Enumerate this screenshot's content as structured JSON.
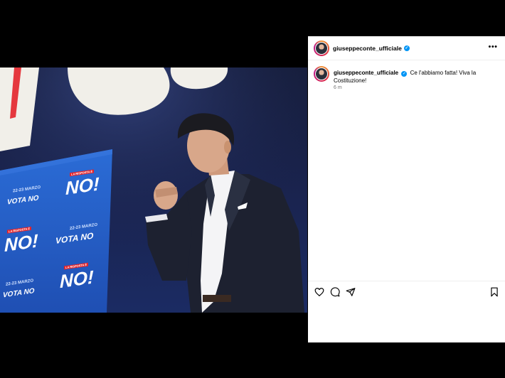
{
  "post": {
    "username": "giuseppeconte_ufficiale",
    "verified_badge": "✓",
    "more_label": "•••",
    "caption_user": "giuseppeconte_ufficiale",
    "caption_text": "Ce l'abbiamo fatta! Viva la Costituzione!",
    "time": "6 m"
  },
  "photo": {
    "backdrop_text": "NO!",
    "banners": [
      {
        "small": "LA RISPOSTA È",
        "date": "22-23 MARZO",
        "big": "NO!",
        "vote": "VOTA NO"
      },
      {
        "small": "LA RISPOSTA È",
        "date": "22-23 MARZO",
        "big": "NO!",
        "vote": "VOTA NO"
      },
      {
        "small": "LA RISPOSTA È",
        "date": "22-23 MARZO",
        "big": "NO!",
        "vote": "VOTA NO"
      }
    ]
  },
  "icons": {
    "like": "heart-icon",
    "comment": "comment-icon",
    "share": "share-icon",
    "save": "bookmark-icon"
  },
  "colors": {
    "accent": "#0095f6",
    "banner_red": "#e3242b",
    "stage_blue": "#1b2b63"
  }
}
